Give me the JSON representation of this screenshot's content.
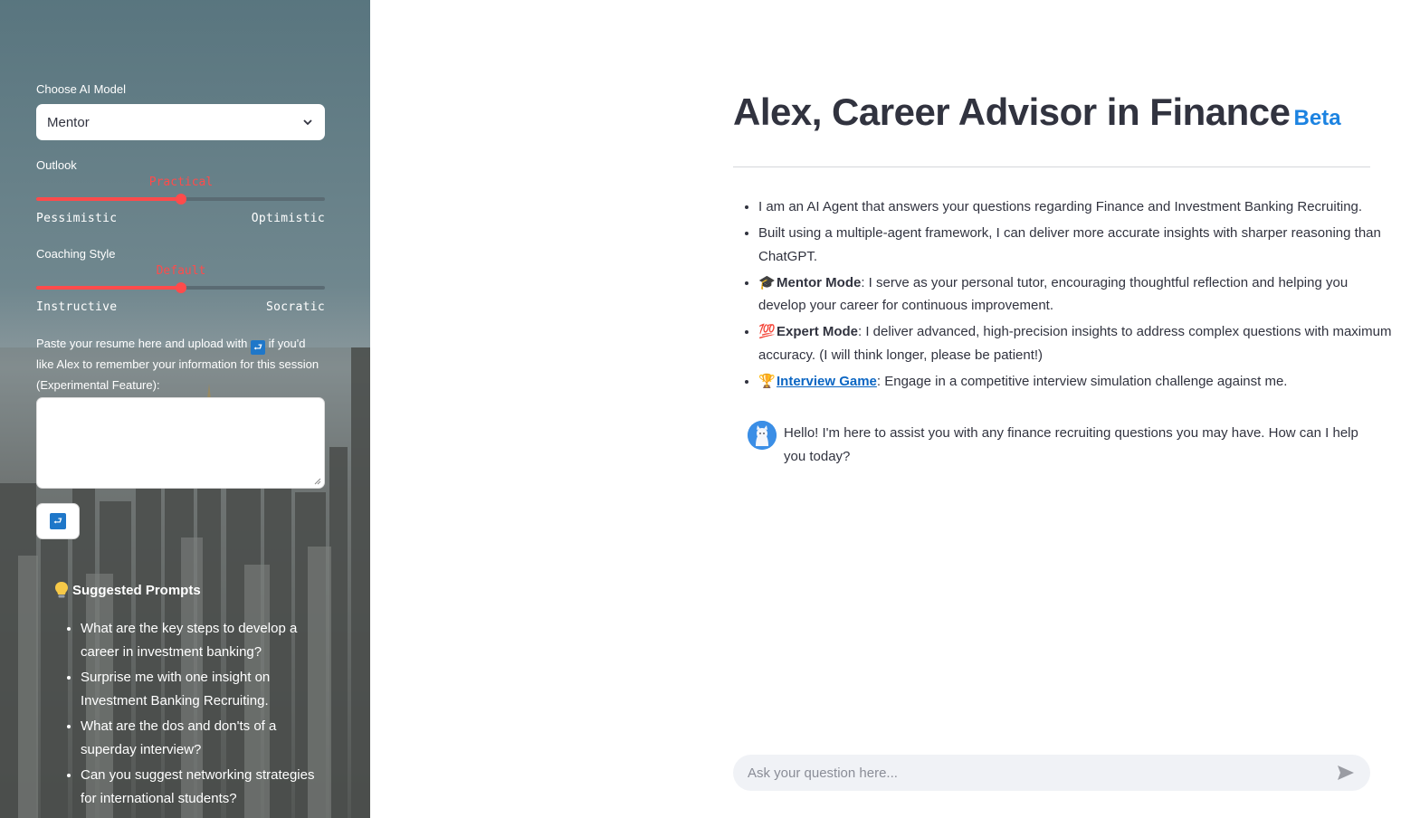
{
  "sidebar": {
    "model_label": "Choose AI Model",
    "model_selected": "Mentor",
    "outlook": {
      "label": "Outlook",
      "value": "Practical",
      "min": "Pessimistic",
      "max": "Optimistic",
      "fraction": 0.5
    },
    "coaching": {
      "label": "Coaching Style",
      "value": "Default",
      "min": "Instructive",
      "max": "Socratic",
      "fraction": 0.5
    },
    "resume_text_a": "Paste your resume here and upload with",
    "resume_text_b": "if you'd like Alex to remember your information for this session (Experimental Feature):",
    "upload_icon": "return-arrow-icon",
    "suggested_title": "Suggested Prompts",
    "suggested_icon": "lightbulb-icon",
    "prompts": [
      "What are the key steps to develop a career in investment banking?",
      "Surprise me with one insight on Investment Banking Recruiting.",
      "What are the dos and don'ts of a superday interview?",
      "Can you suggest networking strategies for international students?"
    ]
  },
  "main": {
    "title": "Alex, Career Advisor in Finance",
    "badge": "Beta",
    "features": {
      "f1": "I am an AI Agent that answers your questions regarding Finance and Investment Banking Recruiting.",
      "f2": "Built using a multiple-agent framework, I can deliver more accurate insights with sharper reasoning than ChatGPT.",
      "f3_emoji": "🎓",
      "f3_bold": "Mentor Mode",
      "f3_text": ": I serve as your personal tutor, encouraging thoughtful reflection and helping you develop your career for continuous improvement.",
      "f4_emoji": "💯",
      "f4_bold": "Expert Mode",
      "f4_text": ": I deliver advanced, high-precision insights to address complex questions with maximum accuracy. (I will think longer, please be patient!)",
      "f5_emoji": "🏆",
      "f5_link": "Interview Game",
      "f5_text": ": Engage in a competitive interview simulation challenge against me."
    },
    "greeting": "Hello! I'm here to assist you with any finance recruiting questions you may have. How can I help you today?",
    "chat_placeholder": "Ask your question here...",
    "accent_color": "#1c83e1",
    "slider_color": "#ff4b4b"
  }
}
